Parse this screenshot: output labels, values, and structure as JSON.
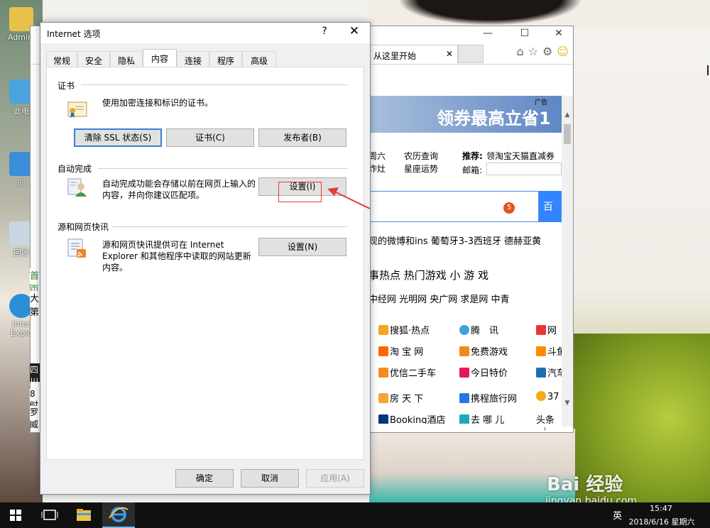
{
  "desktop": {
    "icons": [
      {
        "label": "Admini"
      },
      {
        "label": "此电"
      },
      {
        "label": "网"
      },
      {
        "label": "回收"
      },
      {
        "label": "Inter Explo"
      }
    ]
  },
  "browser": {
    "tab_label": "从这里开始",
    "tab_close": "✕",
    "banner_text": "领券最高立省1",
    "banner_ad": "广告",
    "links": {
      "row1_a": "周六",
      "row1_b": "农历查询",
      "row1_c": "推荐:",
      "row1_d": "领淘宝天猫直减券",
      "row2_a": "炸灶",
      "row2_b": "星座运势",
      "row2_c": "邮箱:",
      "badge": "5",
      "news": "现的微博和ins    葡萄牙3-3西班牙    德赫亚黄",
      "nav1": "事热点     热门游戏      小 游 戏",
      "nav2": "中经网    光明网    央广网    求是网    中青",
      "site_r1": [
        "搜狐·热点",
        "腾　讯",
        "网"
      ],
      "site_r2": [
        "淘 宝 网",
        "免费游戏",
        "斗鱼"
      ],
      "site_r3": [
        "优信二手车",
        "今日特价",
        "汽车"
      ],
      "site_r4": [
        "房 天 下",
        "携程旅行网",
        "37"
      ],
      "site_r5": [
        "Booking酒店",
        "去 哪 儿",
        "头条"
      ]
    },
    "left_strip": [
      "首页",
      "大第",
      "四川",
      "8时",
      "罗威"
    ]
  },
  "dialog": {
    "title": "Internet 选项",
    "help": "?",
    "close": "✕",
    "tabs": [
      "常规",
      "安全",
      "隐私",
      "内容",
      "连接",
      "程序",
      "高级"
    ],
    "active_tab": "内容",
    "cert": {
      "title": "证书",
      "desc": "使用加密连接和标识的证书。",
      "btn_clear_ssl": "清除 SSL 状态(S)",
      "btn_cert": "证书(C)",
      "btn_publisher": "发布者(B)"
    },
    "autocomplete": {
      "title": "自动完成",
      "desc_line1": "自动完成功能会存储以前在网页上输入的",
      "desc_line2": "内容，并向你建议匹配项。",
      "btn_settings": "设置(I)"
    },
    "feeds": {
      "title": "源和网页快讯",
      "desc_line1": "源和网页快讯提供可在 Internet",
      "desc_line2": "Explorer 和其他程序中读取的网站更新",
      "desc_line3": "内容。",
      "btn_settings": "设置(N)"
    },
    "footer": {
      "ok": "确定",
      "cancel": "取消",
      "apply": "应用(A)"
    }
  },
  "taskbar": {
    "tray_ime": "英",
    "time": "15:47",
    "date": "2018/6/16 星期六"
  },
  "watermark": {
    "logo": "Bai 经验",
    "url": "jingyan.baidu.com"
  },
  "colors": {
    "accent": "#3c7fd4",
    "highlight": "#e43b3b",
    "taskbar": "#101010"
  }
}
